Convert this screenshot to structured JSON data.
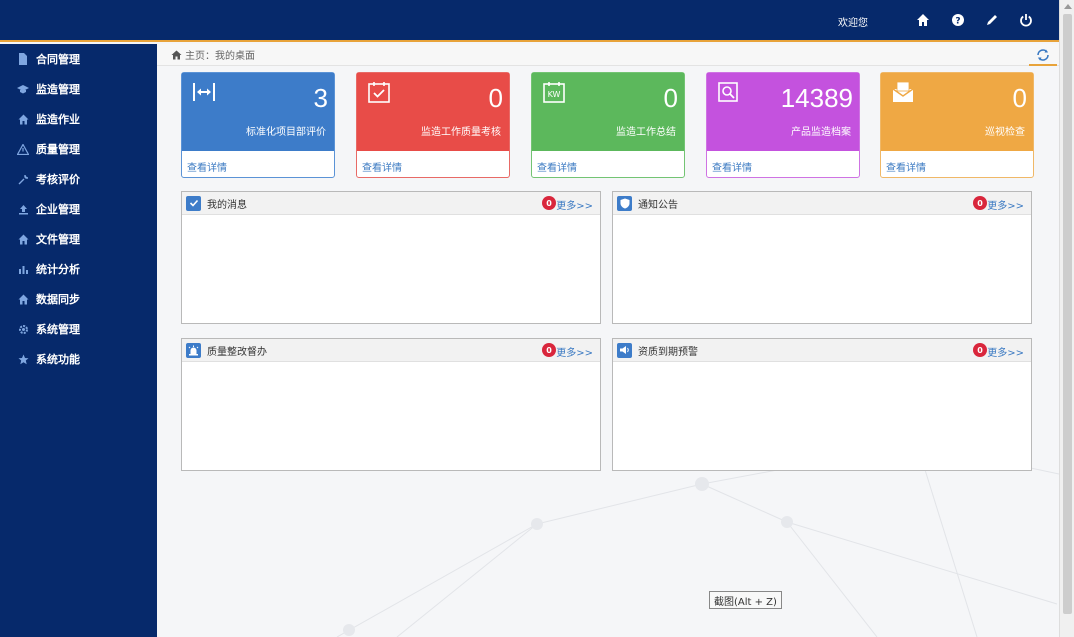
{
  "topbar": {
    "welcome": "欢迎您"
  },
  "breadcrumb": {
    "text": "主页：我的桌面"
  },
  "sidebar": {
    "items": [
      {
        "label": "合同管理",
        "icon": "file-icon"
      },
      {
        "label": "监造管理",
        "icon": "graduation-icon"
      },
      {
        "label": "监造作业",
        "icon": "home-icon"
      },
      {
        "label": "质量管理",
        "icon": "warning-icon"
      },
      {
        "label": "考核评价",
        "icon": "wrench-icon"
      },
      {
        "label": "企业管理",
        "icon": "upload-icon"
      },
      {
        "label": "文件管理",
        "icon": "home-icon"
      },
      {
        "label": "统计分析",
        "icon": "bar-chart-icon"
      },
      {
        "label": "数据同步",
        "icon": "home-icon"
      },
      {
        "label": "系统管理",
        "icon": "gear-icon"
      },
      {
        "label": "系统功能",
        "icon": "star-icon"
      }
    ]
  },
  "cards": [
    {
      "value": "3",
      "label": "标准化项目部评价",
      "detail": "查看详情",
      "color": "#3d7cc9",
      "border": "#5b93d6",
      "icon": "swap-icon"
    },
    {
      "value": "0",
      "label": "监造工作质量考核",
      "detail": "查看详情",
      "color": "#e84c48",
      "border": "#e86a66",
      "icon": "calendar-check-icon"
    },
    {
      "value": "0",
      "label": "监造工作总结",
      "detail": "查看详情",
      "color": "#5cb85c",
      "border": "#73c473",
      "icon": "kw-calendar-icon"
    },
    {
      "value": "14389",
      "label": "产品监造档案",
      "detail": "查看详情",
      "color": "#c452de",
      "border": "#cf73e3",
      "icon": "search-doc-icon"
    },
    {
      "value": "0",
      "label": "巡视检查",
      "detail": "查看详情",
      "color": "#efa844",
      "border": "#f0b867",
      "icon": "envelope-icon"
    }
  ],
  "panels": [
    {
      "title": "我的消息",
      "badge": "0",
      "more": "更多>>",
      "icon": "check-icon"
    },
    {
      "title": "通知公告",
      "badge": "0",
      "more": "更多>>",
      "icon": "shield-icon"
    },
    {
      "title": "质量整改督办",
      "badge": "0",
      "more": "更多>>",
      "icon": "siren-icon"
    },
    {
      "title": "资质到期预警",
      "badge": "0",
      "more": "更多>>",
      "icon": "speaker-icon"
    }
  ],
  "tooltip": "截图(Alt + Z)"
}
